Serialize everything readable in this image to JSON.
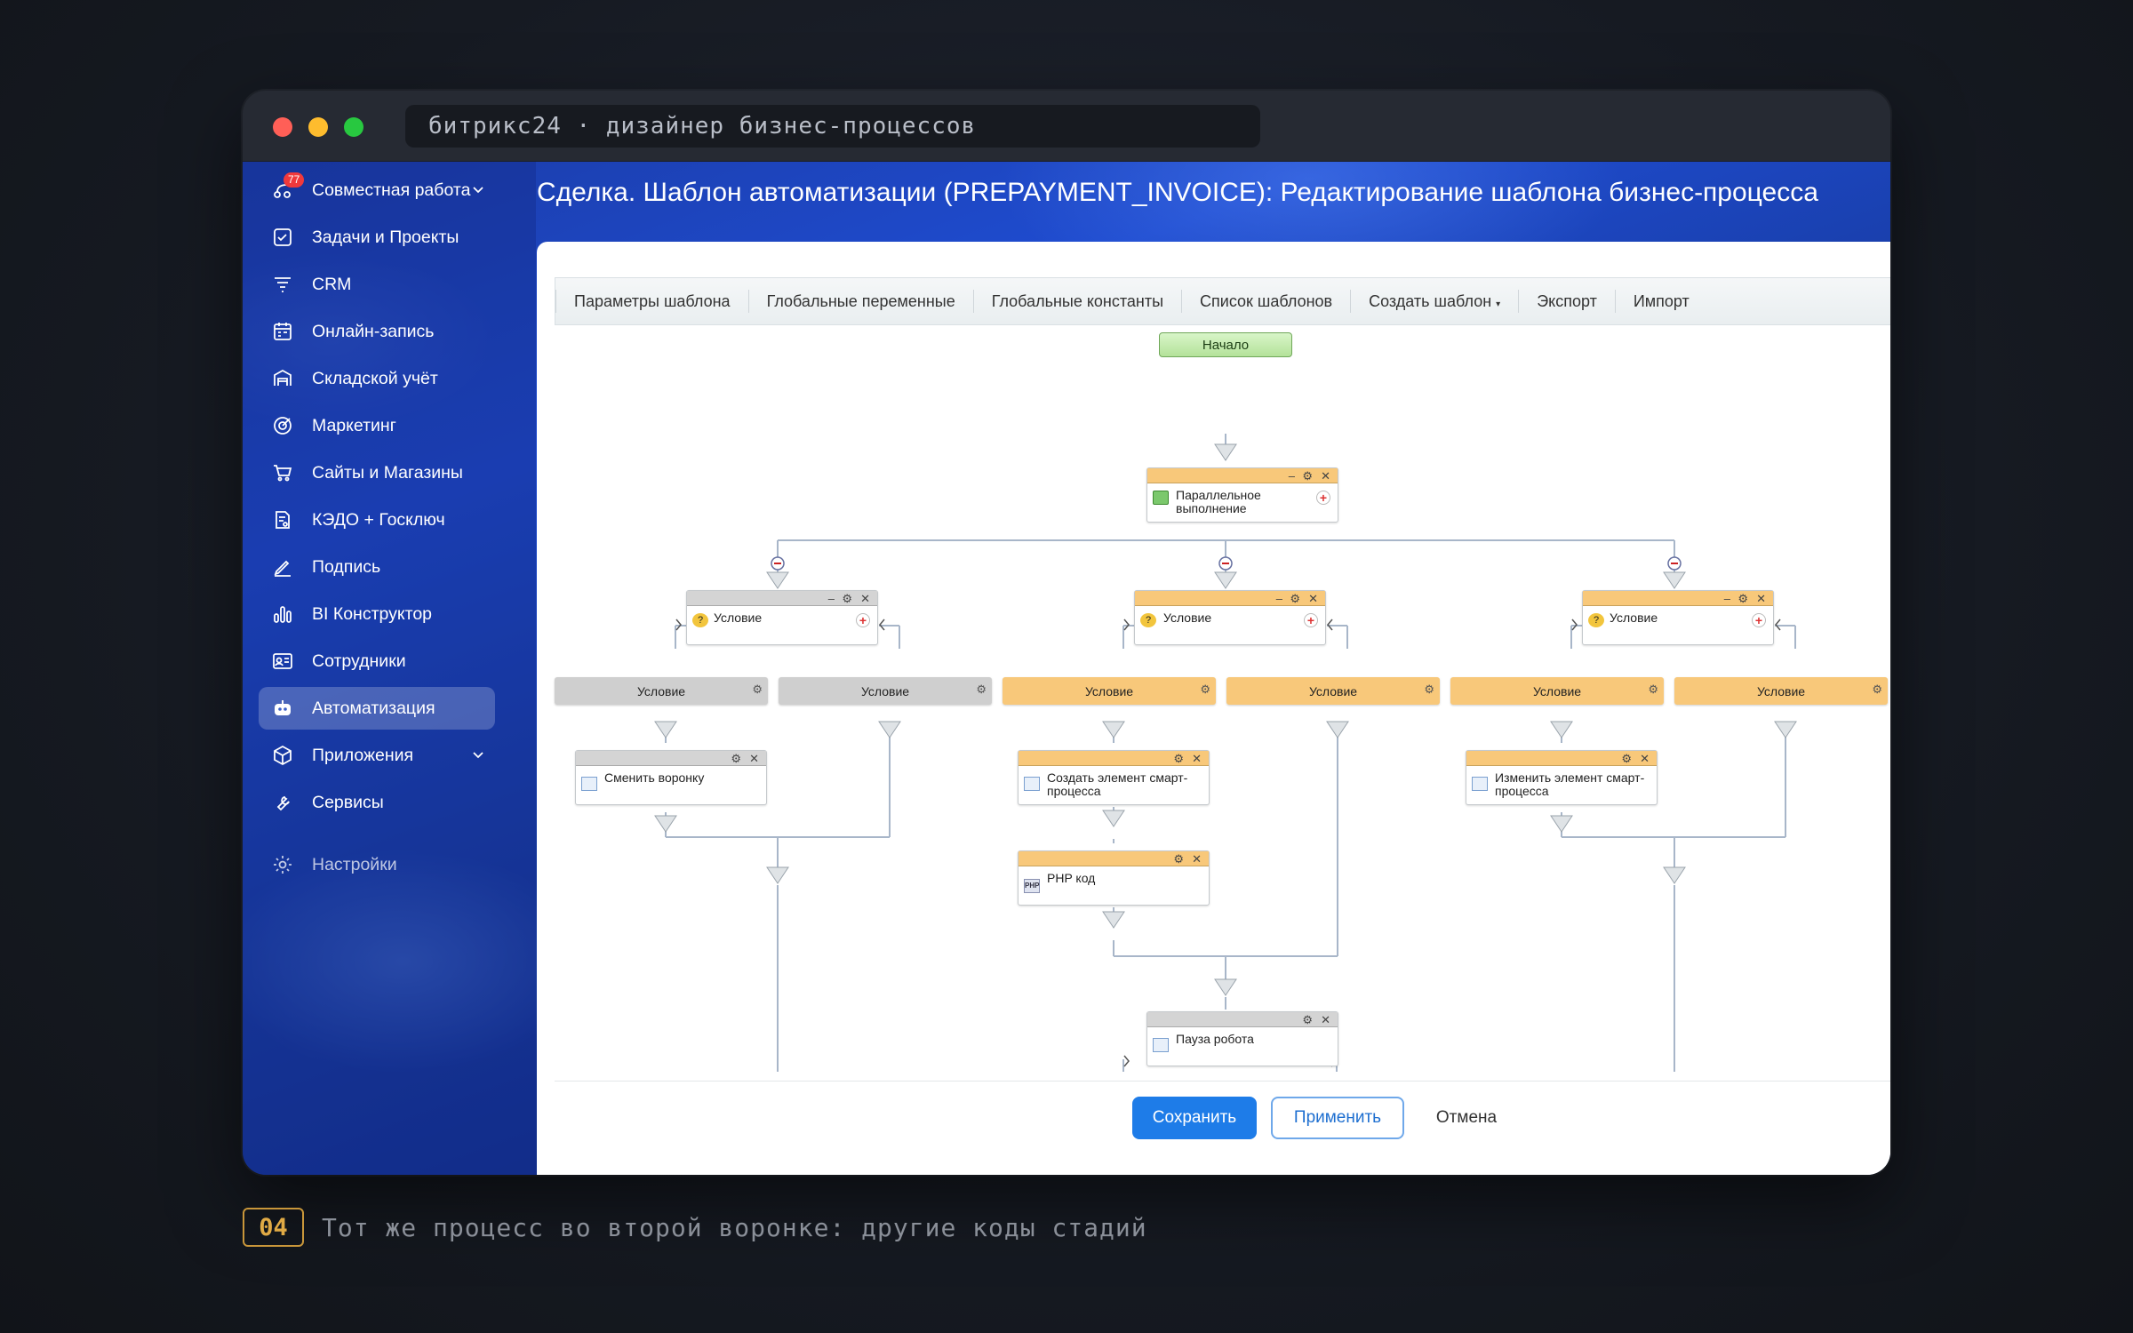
{
  "window": {
    "url_text": "битрикс24 · дизайнер бизнес-процессов"
  },
  "sidebar": {
    "items": [
      {
        "label": "Совместная работа",
        "badge": "77"
      },
      {
        "label": "Задачи и Проекты"
      },
      {
        "label": "CRM"
      },
      {
        "label": "Онлайн-запись"
      },
      {
        "label": "Складской учёт"
      },
      {
        "label": "Маркетинг"
      },
      {
        "label": "Сайты и Магазины"
      },
      {
        "label": "КЭДО + Госключ"
      },
      {
        "label": "Подпись"
      },
      {
        "label": "BI Конструктор"
      },
      {
        "label": "Сотрудники"
      },
      {
        "label": "Автоматизация"
      },
      {
        "label": "Приложения"
      },
      {
        "label": "Сервисы"
      },
      {
        "label": "Настройки"
      }
    ],
    "active": "Автоматизация"
  },
  "page": {
    "title": "Сделка. Шаблон автоматизации (PREPAYMENT_INVOICE): Редактирование шаблона бизнес-процесса"
  },
  "toolbar": {
    "items": [
      "Параметры шаблона",
      "Глобальные переменные",
      "Глобальные константы",
      "Список шаблонов",
      "Создать шаблон",
      "Экспорт",
      "Импорт"
    ]
  },
  "diagram": {
    "start": "Начало",
    "parallel": "Параллельное выполнение",
    "condition": "Условие",
    "branch_label": "Условие",
    "change_funnel": "Сменить воронку",
    "create_smart": "Создать элемент смарт-процесса",
    "php_code": "PHP код",
    "update_smart": "Изменить элемент смарт-процесса",
    "robot_pause": "Пауза робота",
    "php_badge": "PHP"
  },
  "footer": {
    "save": "Сохранить",
    "apply": "Применить",
    "cancel": "Отмена"
  },
  "caption": {
    "number": "04",
    "text": "Тот же процесс во второй воронке: другие коды стадий"
  },
  "colors": {
    "accent": "#1e7ce8",
    "node_header": "#f8c87a",
    "node_header_gray": "#d4d4d4",
    "caption_number": "#e0aa45"
  }
}
